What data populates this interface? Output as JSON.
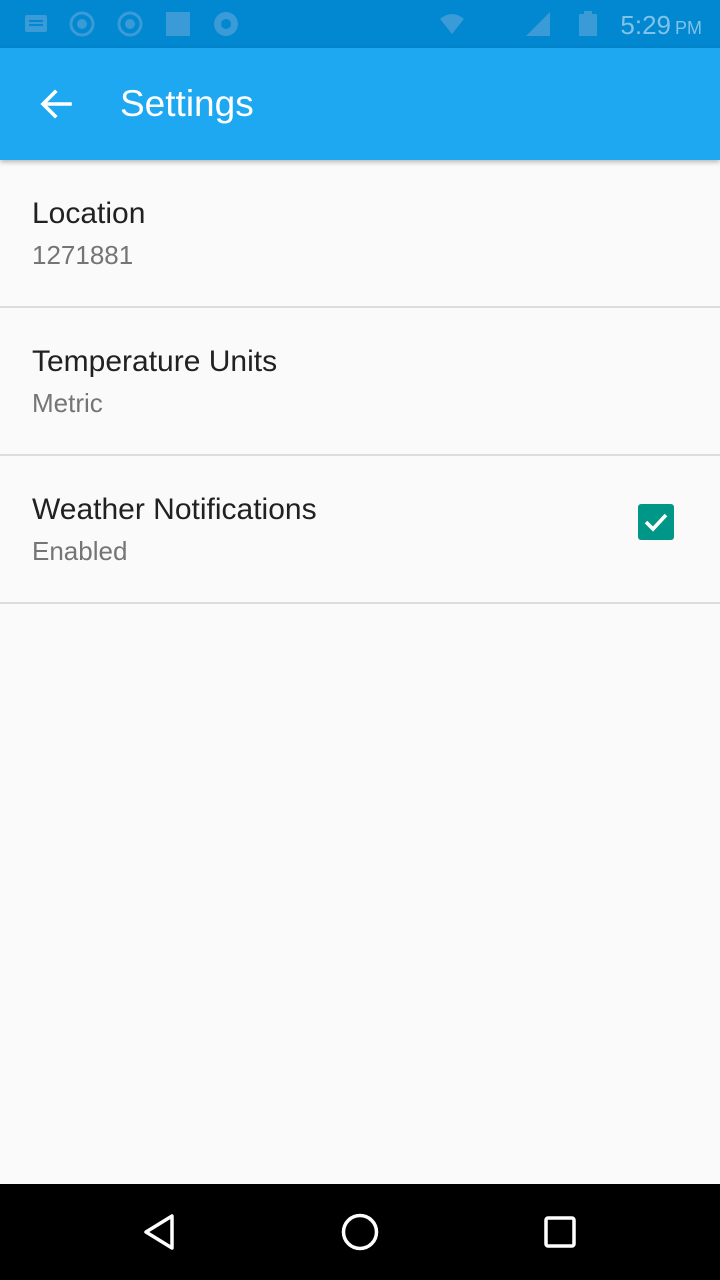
{
  "status_bar": {
    "time": "5:29",
    "am_pm": "PM",
    "icons": [
      "message-icon",
      "whatsapp-icon",
      "whatsapp-icon",
      "gallery-icon",
      "chrome-icon",
      "wifi-icon",
      "signal-icon",
      "battery-icon"
    ],
    "color": "#0288d1"
  },
  "app_bar": {
    "title": "Settings",
    "back_icon": "arrow-back-icon",
    "color": "#1ea8f2"
  },
  "preferences": [
    {
      "title": "Location",
      "summary": "1271881"
    },
    {
      "title": "Temperature Units",
      "summary": "Metric"
    },
    {
      "title": "Weather Notifications",
      "summary": "Enabled",
      "checked": true,
      "accent": "#009688"
    }
  ],
  "nav_bar": {
    "buttons": [
      "back-triangle-icon",
      "home-circle-icon",
      "recents-square-icon"
    ]
  }
}
